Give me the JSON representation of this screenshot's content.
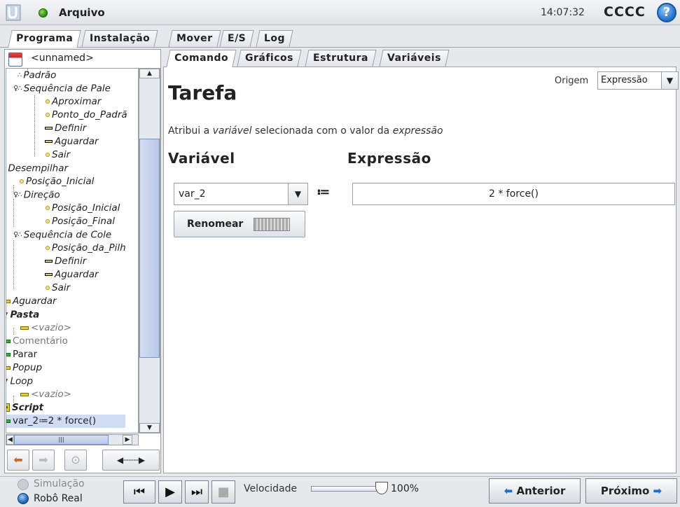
{
  "header": {
    "file_menu": "Arquivo",
    "time": "14:07:32",
    "robot_name": "CCCC",
    "help": "?"
  },
  "main_tabs": [
    {
      "label": "Programa"
    },
    {
      "label": "Instalação"
    },
    {
      "label": "Mover"
    },
    {
      "label": "E/S"
    },
    {
      "label": "Log"
    }
  ],
  "program": {
    "name": "<unnamed>"
  },
  "tree": [
    {
      "label": "Padrão"
    },
    {
      "label": "Sequência de Pale"
    },
    {
      "label": "Aproximar"
    },
    {
      "label": "Ponto_do_Padrã"
    },
    {
      "label": "Definir"
    },
    {
      "label": "Aguardar"
    },
    {
      "label": "Sair"
    },
    {
      "label": "Desempilhar"
    },
    {
      "label": "Posição_Inicial"
    },
    {
      "label": "Direção"
    },
    {
      "label": "Posição_Inicial"
    },
    {
      "label": "Posição_Final"
    },
    {
      "label": "Sequência de Cole"
    },
    {
      "label": "Posição_da_Pilh"
    },
    {
      "label": "Definir"
    },
    {
      "label": "Aguardar"
    },
    {
      "label": "Sair"
    },
    {
      "label": "Aguardar"
    },
    {
      "label": "Pasta"
    },
    {
      "label": "<vazio>"
    },
    {
      "label": "Comentário"
    },
    {
      "label": "Parar"
    },
    {
      "label": "Popup"
    },
    {
      "label": "Loop"
    },
    {
      "label": "<vazio>"
    },
    {
      "label": "Script"
    },
    {
      "label": "var_2≔2 * force()"
    }
  ],
  "sub_tabs": [
    {
      "label": "Comando"
    },
    {
      "label": "Gráficos"
    },
    {
      "label": "Estrutura"
    },
    {
      "label": "Variáveis"
    }
  ],
  "command": {
    "title": "Tarefa",
    "origin_label": "Origem",
    "origin_value": "Expressão",
    "desc_pre": "Atribui a ",
    "desc_var": "variável",
    "desc_mid": " selecionada com o valor da ",
    "desc_expr": "expressão",
    "variable_heading": "Variável",
    "expression_heading": "Expressão",
    "variable_value": "var_2",
    "assign_symbol": "≔",
    "expression_value": "2 * force()",
    "rename_label": "Renomear"
  },
  "footer": {
    "simulation": "Simulação",
    "real_robot": "Robô Real",
    "speed_label": "Velocidade",
    "speed_value": "100%",
    "speed_fraction": 1.0,
    "previous": "Anterior",
    "next": "Próximo"
  },
  "colors": {
    "accent": "#1a6fd0",
    "tab_active": "#ffffff",
    "panel_bg": "#e6e8ec"
  }
}
